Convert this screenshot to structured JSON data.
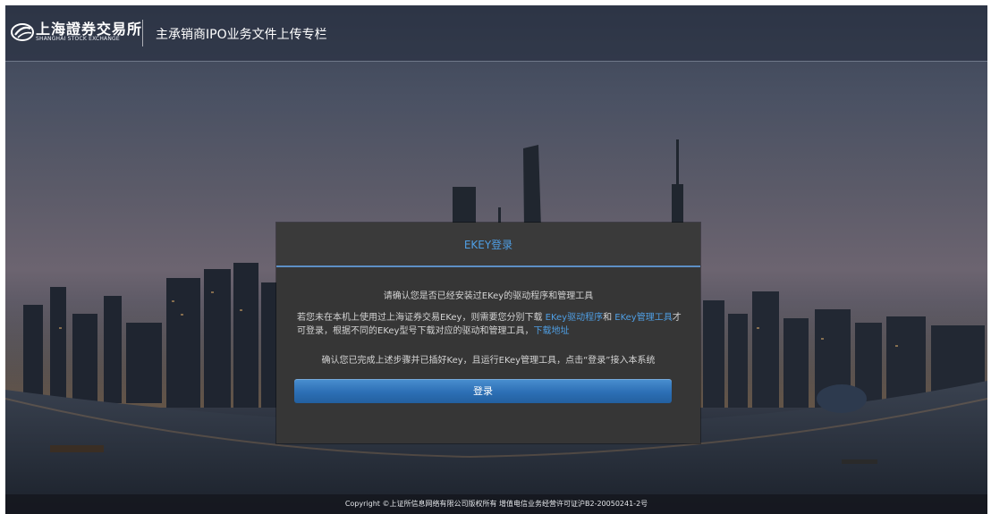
{
  "header": {
    "logo_cn": "上海證券交易所",
    "logo_en": "SHANGHAI STOCK EXCHANGE",
    "title": "主承销商IPO业务文件上传专栏"
  },
  "dialog": {
    "title": "EKEY登录",
    "confirm_line": "请确认您是否已经安装过EKey的驱动程序和管理工具",
    "para": {
      "part1": "若您未在本机上使用过上海证券交易EKey，则需要您分别下载 ",
      "link_driver": "EKey驱动程序",
      "part2": "和 ",
      "link_manager": "EKey管理工具",
      "part3": "才可登录，根据不同的EKey型号下载对应的驱动和管理工具，",
      "link_download": "下载地址"
    },
    "ready_line": "确认您已完成上述步骤并已插好Key，且运行EKey管理工具，点击“登录”接入本系统",
    "login_label": "登录"
  },
  "footer": {
    "copyright": "Copyright ©上证所信息网络有限公司版权所有 增值电信业务经营许可证沪B2-20050241-2号"
  },
  "colors": {
    "accent": "#4f9ee3",
    "button": "#2c6fb5",
    "dialog_bg": "#363636"
  }
}
